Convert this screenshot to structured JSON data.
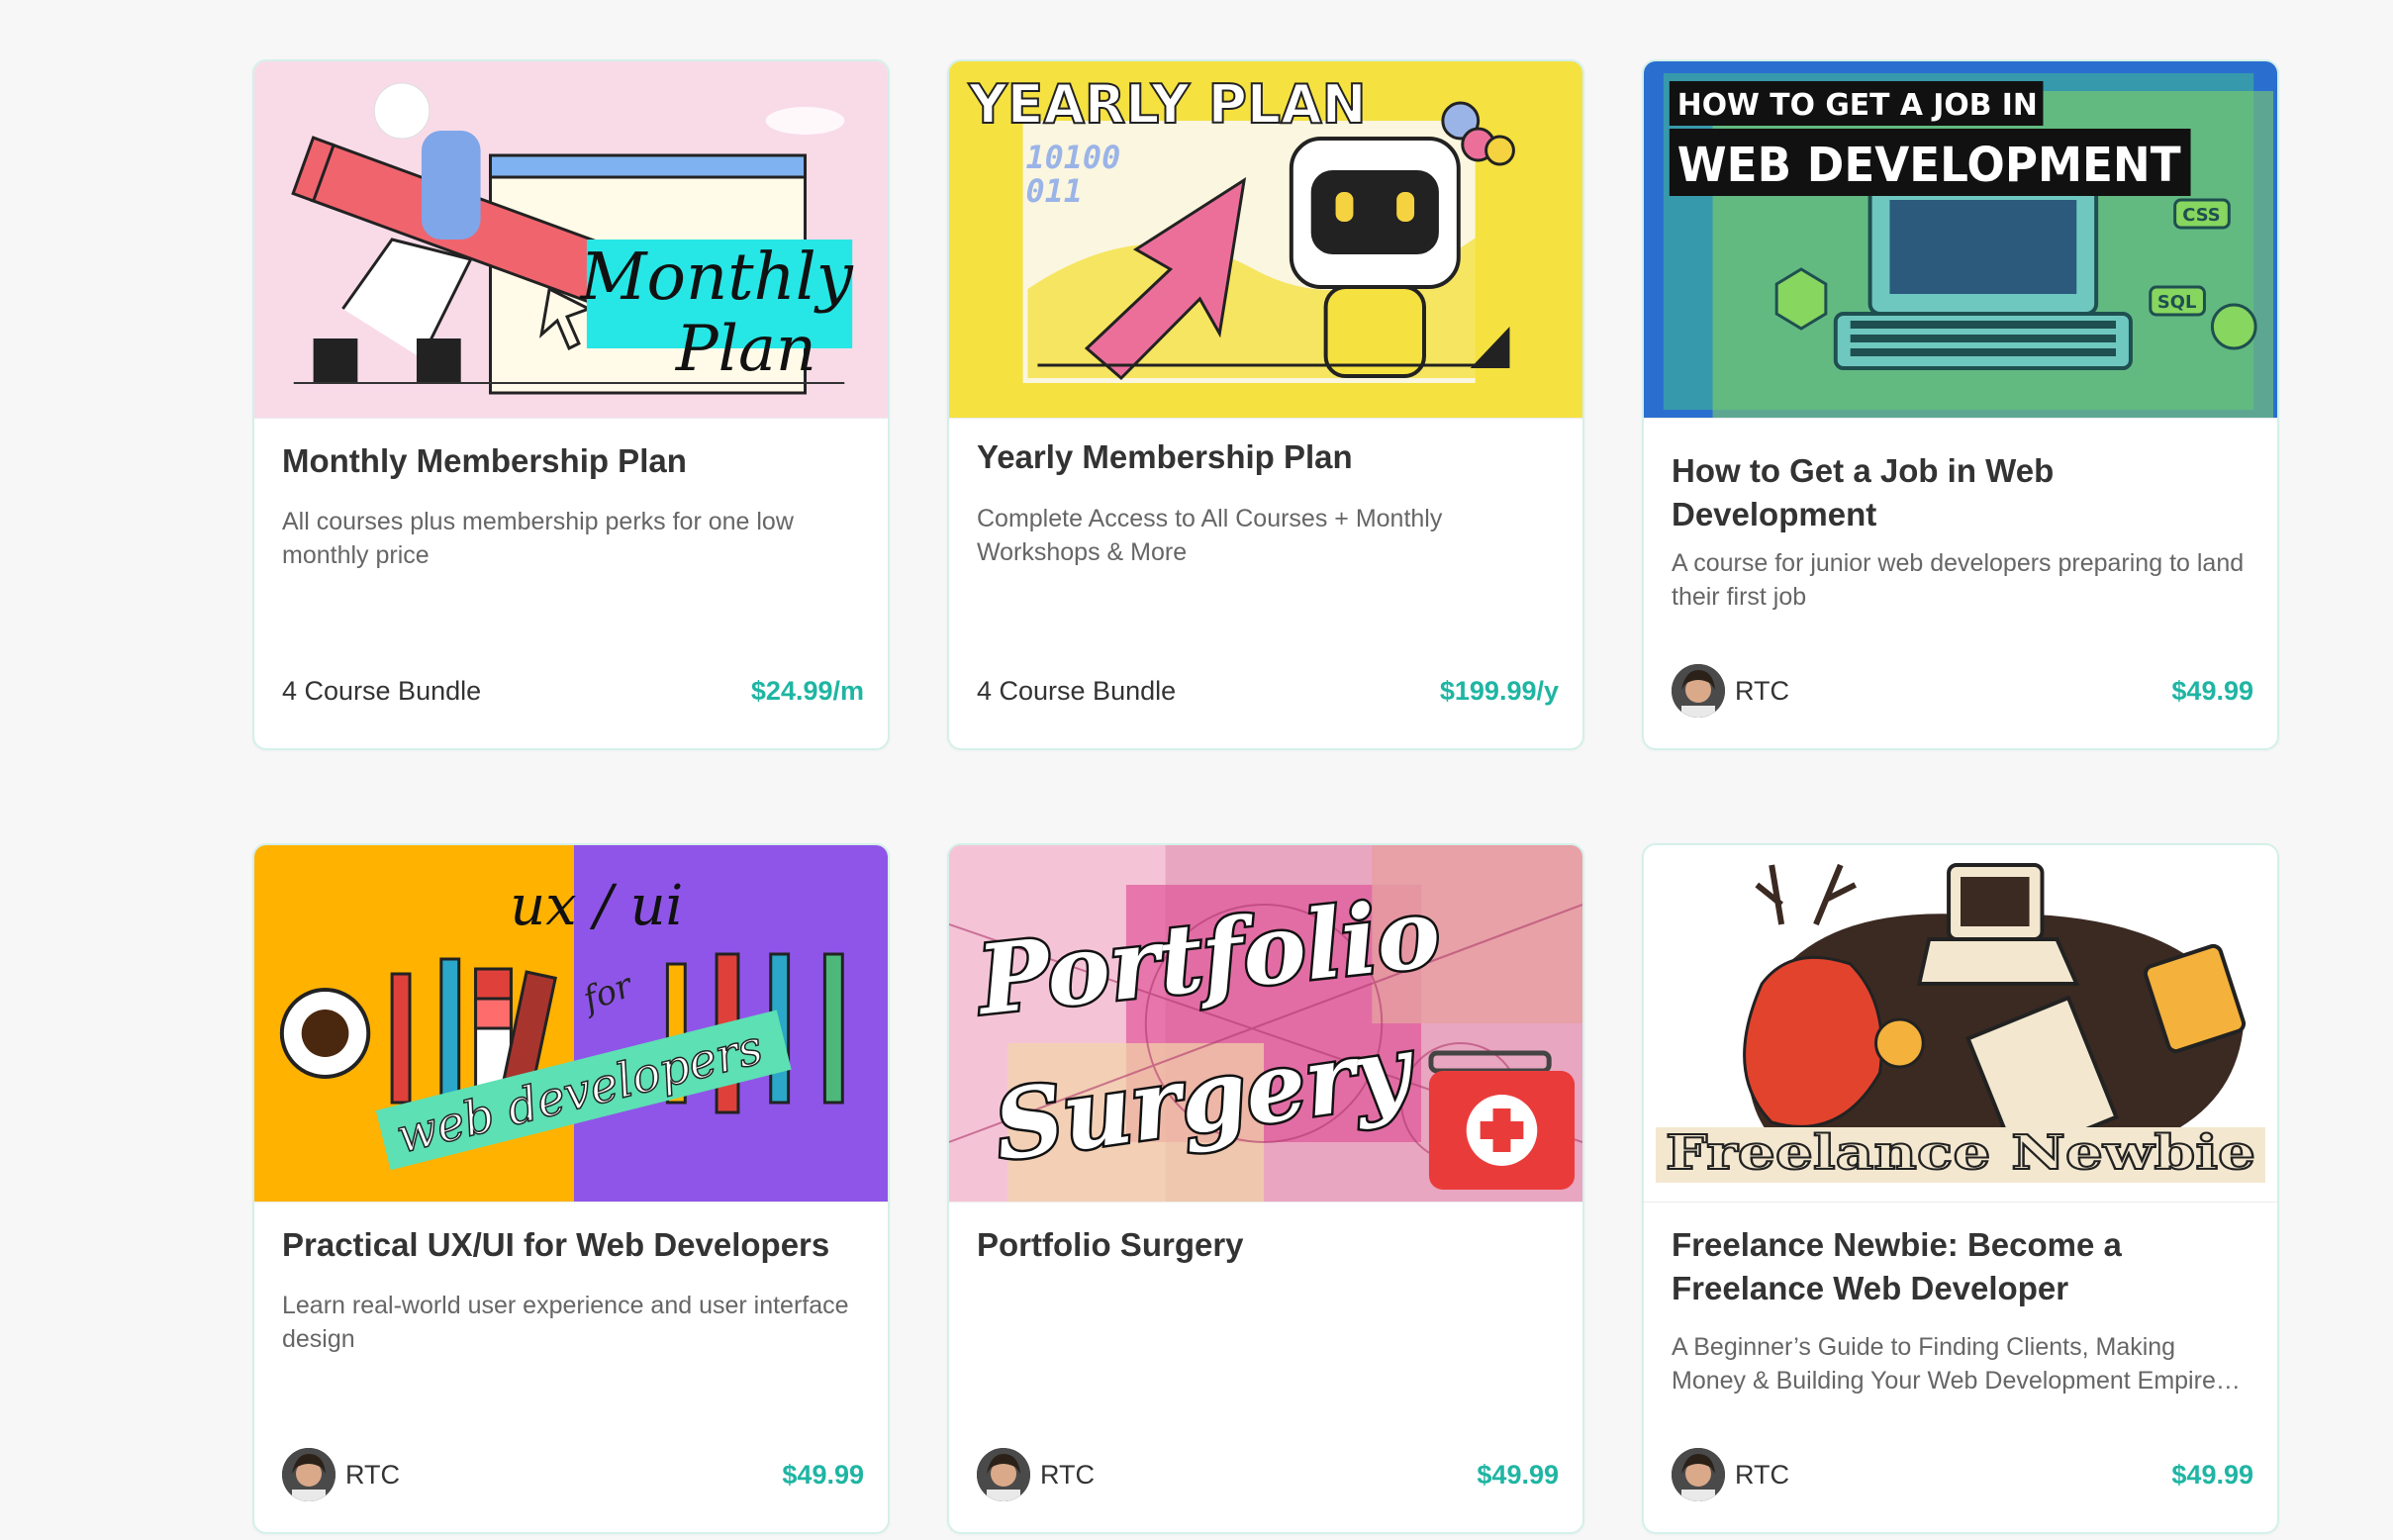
{
  "colors": {
    "accent": "#1fb5a3",
    "page_bg": "#f7f7f7",
    "card_border": "#d4f0ea"
  },
  "cards": [
    {
      "thumb_text": [
        "Monthly",
        "Plan"
      ],
      "title": "Monthly Membership Plan",
      "description": "All courses plus membership perks for one low monthly price",
      "footer_label": "4 Course Bundle",
      "price": "$24.99/m"
    },
    {
      "thumb_text": [
        "YEARLY PLAN",
        "10100",
        "011"
      ],
      "title": "Yearly Membership Plan",
      "description": "Complete Access to All Courses + Monthly Workshops & More",
      "footer_label": "4 Course Bundle",
      "price": "$199.99/y"
    },
    {
      "thumb_text": [
        "HOW TO GET A JOB IN",
        "WEB DEVELOPMENT",
        "CSS",
        "SQL"
      ],
      "title": "How to Get a Job in Web Development",
      "description": "A course for junior web developers preparing to land their first job",
      "author": "RTC",
      "price": "$49.99"
    },
    {
      "thumb_text": [
        "ux / ui",
        "for",
        "web developers"
      ],
      "title": "Practical UX/UI for Web Developers",
      "description": "Learn real-world user experience and user interface design",
      "author": "RTC",
      "price": "$49.99"
    },
    {
      "thumb_text": [
        "Portfolio",
        "Surgery"
      ],
      "title": "Portfolio Surgery",
      "description": "",
      "author": "RTC",
      "price": "$49.99"
    },
    {
      "thumb_text": [
        "Freelance Newbie"
      ],
      "title": "Freelance Newbie: Become a Freelance Web Developer",
      "description": "A Beginner’s Guide to Finding Clients, Making Money & Building Your Web Development Empire…",
      "author": "RTC",
      "price": "$49.99"
    }
  ]
}
